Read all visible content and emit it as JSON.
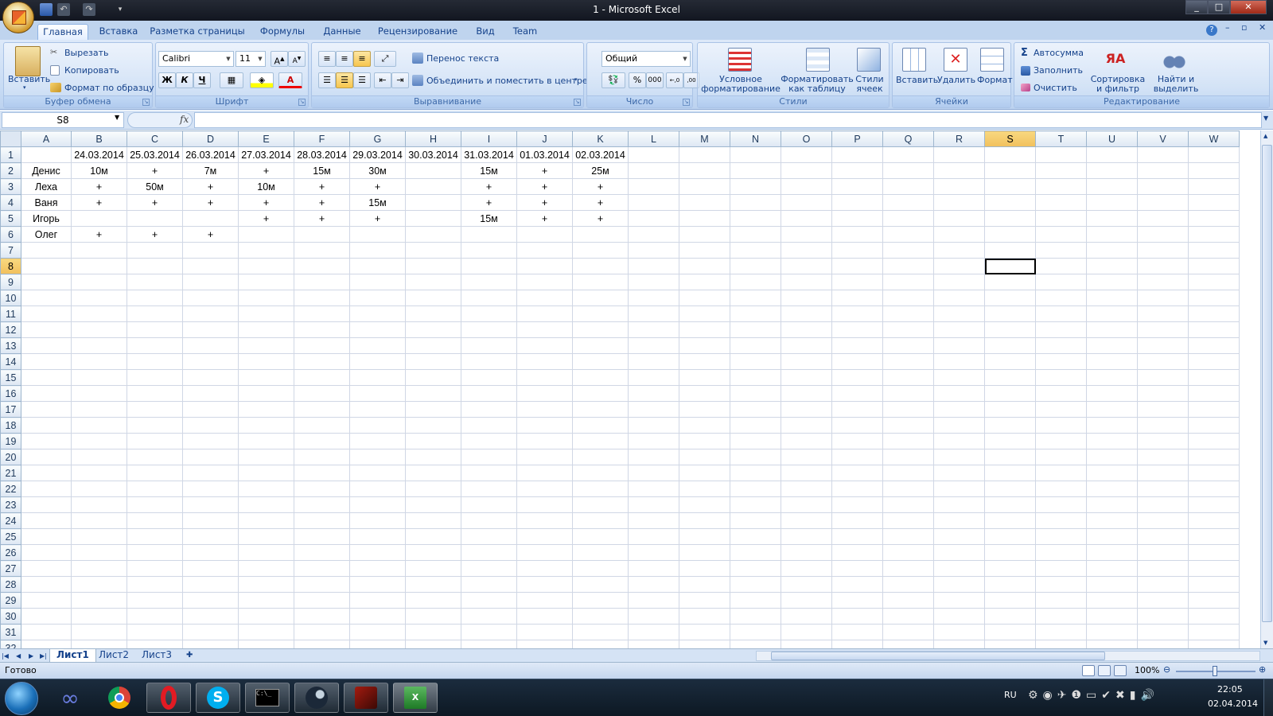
{
  "window": {
    "title": "1 - Microsoft Excel",
    "minimize": "_",
    "maximize": "□",
    "close": "✕"
  },
  "tabs": [
    "Главная",
    "Вставка",
    "Разметка страницы",
    "Формулы",
    "Данные",
    "Рецензирование",
    "Вид",
    "Team"
  ],
  "ribbon": {
    "clipboard": {
      "paste": "Вставить",
      "cut": "Вырезать",
      "copy": "Копировать",
      "format_painter": "Формат по образцу",
      "label": "Буфер обмена"
    },
    "font": {
      "name": "Calibri",
      "size": "11",
      "bold": "Ж",
      "italic": "К",
      "underline": "Ч",
      "label": "Шрифт"
    },
    "alignment": {
      "wrap": "Перенос текста",
      "merge": "Объединить и поместить в центре",
      "label": "Выравнивание"
    },
    "number": {
      "format": "Общий",
      "percent": "%",
      "thousands": "000",
      "label": "Число"
    },
    "styles": {
      "conditional": "Условное форматирование",
      "as_table": "Форматировать как таблицу",
      "cell_styles": "Стили ячеек",
      "label": "Стили"
    },
    "cells": {
      "insert": "Вставить",
      "delete": "Удалить",
      "format": "Формат",
      "label": "Ячейки"
    },
    "editing": {
      "autosum": "Автосумма",
      "fill": "Заполнить",
      "clear": "Очистить",
      "sort": "Сортировка и фильтр",
      "find": "Найти и выделить",
      "label": "Редактирование"
    }
  },
  "formula_bar": {
    "name_box": "S8",
    "fx": "fx",
    "value": ""
  },
  "sheet": {
    "columns": [
      "A",
      "B",
      "C",
      "D",
      "E",
      "F",
      "G",
      "H",
      "I",
      "J",
      "K",
      "L",
      "M",
      "N",
      "O",
      "P",
      "Q",
      "R",
      "S",
      "T",
      "U",
      "V",
      "W"
    ],
    "selected_column": "S",
    "selected_row": 8,
    "row_count": 32,
    "rows": [
      [
        "",
        "24.03.2014",
        "25.03.2014",
        "26.03.2014",
        "27.03.2014",
        "28.03.2014",
        "29.03.2014",
        "30.03.2014",
        "31.03.2014",
        "01.03.2014",
        "02.03.2014"
      ],
      [
        "Денис",
        "10м",
        "+",
        "7м",
        "+",
        "15м",
        "30м",
        "",
        "15м",
        "+",
        "25м"
      ],
      [
        "Леха",
        "+",
        "50м",
        "+",
        "10м",
        "+",
        "+",
        "",
        "+",
        "+",
        "+"
      ],
      [
        "Ваня",
        "+",
        "+",
        "+",
        "+",
        "+",
        "15м",
        "",
        "+",
        "+",
        "+"
      ],
      [
        "Игорь",
        "",
        "",
        "",
        "+",
        "+",
        "+",
        "",
        "15м",
        "+",
        "+"
      ],
      [
        "Олег",
        "+",
        "+",
        "+",
        "",
        "",
        "",
        "",
        "",
        "",
        ""
      ]
    ]
  },
  "sheet_tabs": [
    "Лист1",
    "Лист2",
    "Лист3"
  ],
  "status": {
    "ready": "Готово",
    "zoom": "100%"
  },
  "taskbar": {
    "lang": "RU",
    "time": "22:05",
    "date": "02.04.2014"
  },
  "colors": {
    "accent": "#15428b",
    "selected_header": "#f1c05c",
    "grid": "#d0d7e5"
  }
}
